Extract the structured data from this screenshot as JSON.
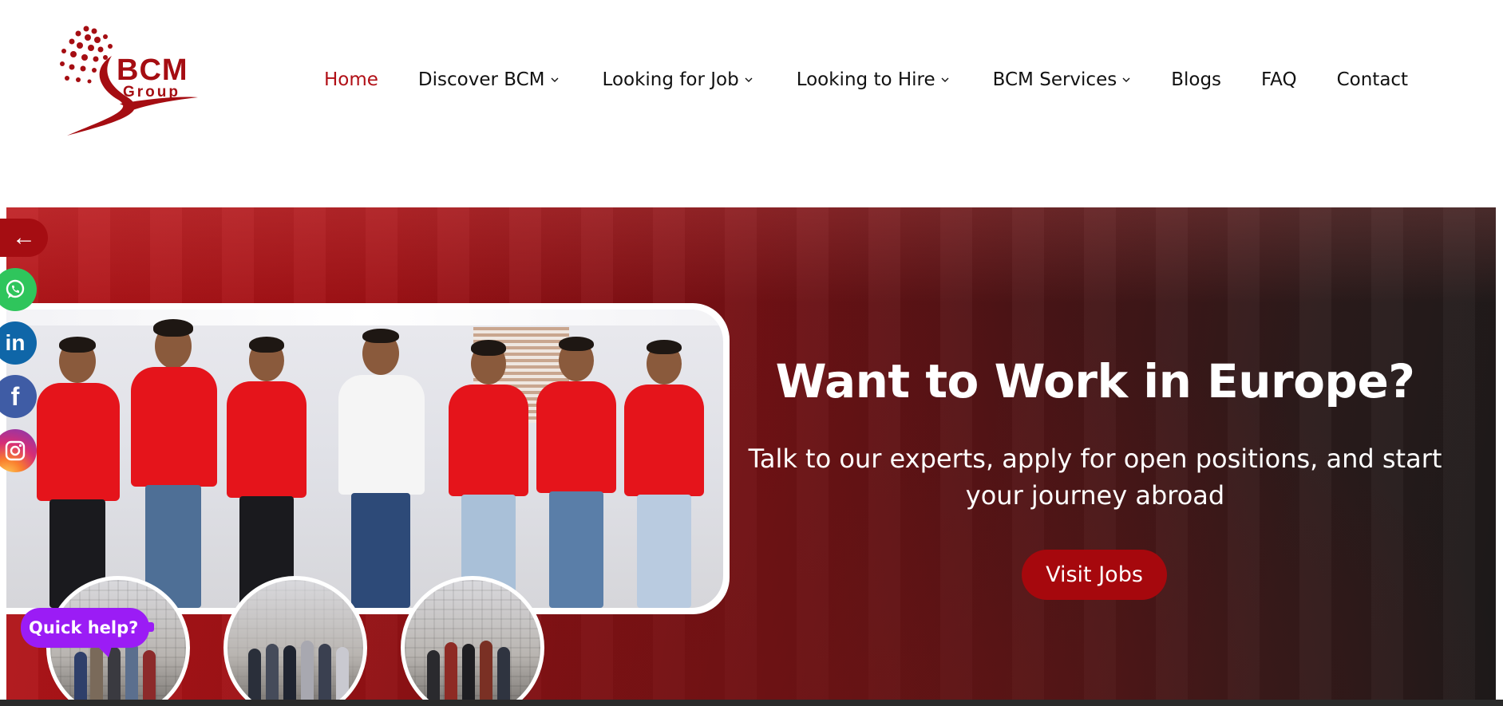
{
  "logo": {
    "brand": "BCM",
    "sub": "Group",
    "color": "#a50d12"
  },
  "nav": {
    "items": [
      {
        "label": "Home",
        "active": true,
        "dropdown": false
      },
      {
        "label": "Discover BCM",
        "active": false,
        "dropdown": true
      },
      {
        "label": "Looking for Job",
        "active": false,
        "dropdown": true
      },
      {
        "label": "Looking to Hire",
        "active": false,
        "dropdown": true
      },
      {
        "label": "BCM Services",
        "active": false,
        "dropdown": true
      },
      {
        "label": "Blogs",
        "active": false,
        "dropdown": false
      },
      {
        "label": "FAQ",
        "active": false,
        "dropdown": false
      },
      {
        "label": "Contact",
        "active": false,
        "dropdown": false
      }
    ],
    "active_color": "#b10f16"
  },
  "hero": {
    "title": "Want to Work in Europe?",
    "subtitle": "Talk to our experts, apply for open positions, and start your journey abroad",
    "cta_label": "Visit Jobs",
    "cta_color": "#a6080d"
  },
  "side": {
    "back_icon": "arrow-left-icon",
    "socials": [
      {
        "name": "whatsapp",
        "icon": "whatsapp-icon",
        "color": "#2fc55c"
      },
      {
        "name": "linkedin",
        "icon": "linkedin-icon",
        "glyph": "in",
        "color": "#0f66a8"
      },
      {
        "name": "facebook",
        "icon": "facebook-icon",
        "glyph": "f",
        "color": "#3f5ca5"
      },
      {
        "name": "instagram",
        "icon": "instagram-icon",
        "color": "#d62d76"
      }
    ]
  },
  "chat": {
    "label": "Quick help?",
    "color": "#9b1cf5"
  }
}
